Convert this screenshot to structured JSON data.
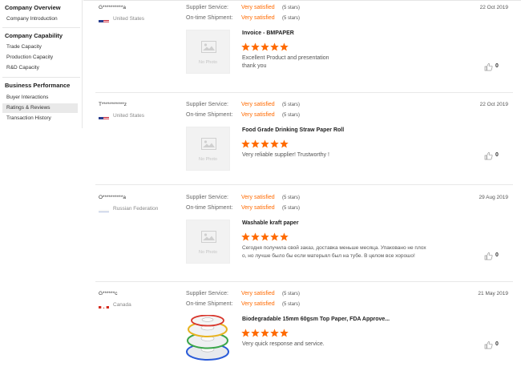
{
  "sidebar": {
    "sections": [
      {
        "title": "Company Overview",
        "items": [
          {
            "label": "Company Introduction",
            "active": false
          }
        ]
      },
      {
        "title": "Company Capability",
        "items": [
          {
            "label": "Trade Capacity",
            "active": false
          },
          {
            "label": "Production Capacity",
            "active": false
          },
          {
            "label": "R&D Capacity",
            "active": false
          }
        ]
      },
      {
        "title": "Business Performance",
        "items": [
          {
            "label": "Buyer Interactions",
            "active": false
          },
          {
            "label": "Ratings & Reviews",
            "active": true
          },
          {
            "label": "Transaction History",
            "active": false
          }
        ]
      }
    ]
  },
  "labels": {
    "supplier_service": "Supplier Service:",
    "ontime_shipment": "On-time Shipment:",
    "no_photo": "No Photo"
  },
  "colors": {
    "accent": "#ff6a00",
    "active_bg": "#e9e9e9"
  },
  "reviews": [
    {
      "user": "G**********a",
      "country": "United States",
      "flag": "us-flag",
      "date": "22 Oct 2019",
      "supplier_service": "Very satisfied",
      "supplier_stars": "(5 stars)",
      "ontime_shipment": "Very satisfied",
      "ontime_stars": "(5 stars)",
      "product": "Invoice - BMPAPER",
      "rating": 5,
      "comment_lines": [
        "Excellent Product and presentation",
        "thank you"
      ],
      "likes": "0",
      "has_photo": false
    },
    {
      "user": "T***********z",
      "country": "United States",
      "flag": "us-flag",
      "date": "22 Oct 2019",
      "supplier_service": "Very satisfied",
      "supplier_stars": "(5 stars)",
      "ontime_shipment": "Very satisfied",
      "ontime_stars": "(5 stars)",
      "product": "Food Grade Drinking Straw Paper Roll",
      "rating": 5,
      "comment_lines": [
        "Very reliable supplier! Trustworthy !"
      ],
      "likes": "0",
      "has_photo": false
    },
    {
      "user": "O**********a",
      "country": "Russian Federation",
      "flag": "ru-flag",
      "date": "29 Aug 2019",
      "supplier_service": "Very satisfied",
      "supplier_stars": "(5 stars)",
      "ontime_shipment": "Very satisfied",
      "ontime_stars": "(5 stars)",
      "product": "Washable kraft paper",
      "rating": 5,
      "comment_lines": [
        "Сегодня получила свой заказ, доставка меньше месяца. Упаковано не плох",
        "о, но лучше было бы если матерьял был на тубе. В целом все хорошо!"
      ],
      "likes": "0",
      "has_photo": false
    },
    {
      "user": "G******c",
      "country": "Canada",
      "flag": "ca-flag",
      "date": "21 May 2019",
      "supplier_service": "Very satisfied",
      "supplier_stars": "(5 stars)",
      "ontime_shipment": "Very satisfied",
      "ontime_stars": "(5 stars)",
      "product": "Biodegradable 15mm 60gsm Top Paper, FDA Approve...",
      "rating": 5,
      "comment_lines": [
        "Very quick response and service."
      ],
      "likes": "0",
      "has_photo": true
    }
  ]
}
